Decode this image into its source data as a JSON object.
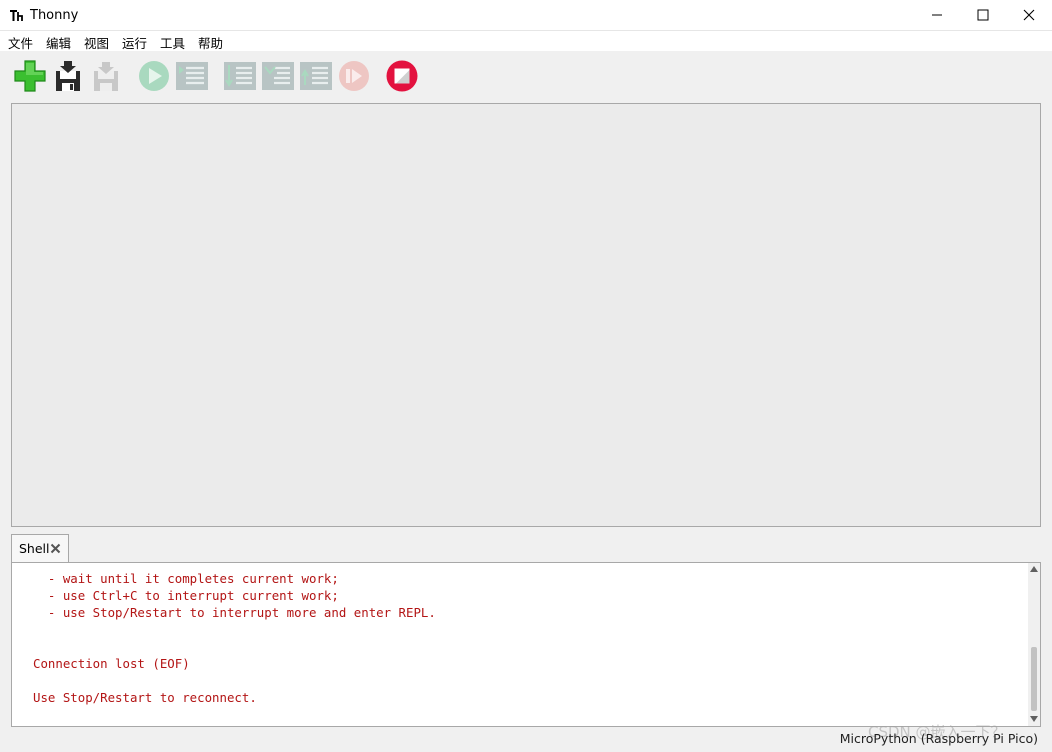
{
  "window": {
    "title": "Thonny"
  },
  "menu": [
    "文件",
    "编辑",
    "视图",
    "运行",
    "工具",
    "帮助"
  ],
  "toolbar": {
    "buttons": [
      {
        "name": "new",
        "icon": "new-file-icon",
        "enabled": true
      },
      {
        "name": "load",
        "icon": "load-file-icon",
        "enabled": true
      },
      {
        "name": "save",
        "icon": "save-file-icon",
        "enabled": false
      },
      {
        "name": "run",
        "icon": "run-icon",
        "enabled": false
      },
      {
        "name": "debug",
        "icon": "debug-icon",
        "enabled": false
      },
      {
        "name": "step-over",
        "icon": "step-over-icon",
        "enabled": false
      },
      {
        "name": "step-into",
        "icon": "step-into-icon",
        "enabled": false
      },
      {
        "name": "step-out",
        "icon": "step-out-icon",
        "enabled": false
      },
      {
        "name": "resume",
        "icon": "resume-icon",
        "enabled": false
      },
      {
        "name": "stop",
        "icon": "stop-icon",
        "enabled": true
      }
    ]
  },
  "shell": {
    "tab_label": "Shell",
    "lines": [
      "  - wait until it completes current work;",
      "  - use Ctrl+C to interrupt current work;",
      "  - use Stop/Restart to interrupt more and enter REPL.",
      "",
      "",
      "Connection lost (EOF)",
      "",
      "Use Stop/Restart to reconnect."
    ],
    "text_color": "#b31515"
  },
  "status": {
    "interpreter": "MicroPython (Raspberry Pi Pico)"
  },
  "watermark": "CSDN @嵌入一下？",
  "colors": {
    "stop_red": "#e3123f",
    "new_green": "#3bbf30",
    "disabled_gray": "#b8c4c4"
  }
}
